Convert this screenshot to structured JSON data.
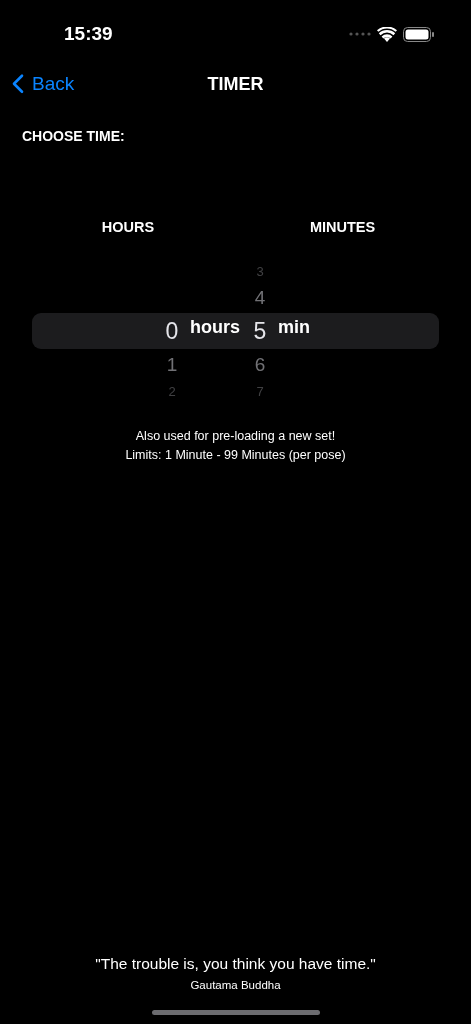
{
  "status_bar": {
    "time": "15:39"
  },
  "nav": {
    "back": "Back",
    "title": "TIMER"
  },
  "section_label": "CHOOSE TIME:",
  "picker": {
    "columns": [
      {
        "heading": "HOURS",
        "unit": "hours",
        "items": [
          {
            "value": "0",
            "selected": true
          },
          {
            "value": "1",
            "selected": false
          },
          {
            "value": "2",
            "selected": false
          }
        ]
      },
      {
        "heading": "MINUTES",
        "unit": "min",
        "items": [
          {
            "value": "3",
            "selected": false
          },
          {
            "value": "4",
            "selected": false
          },
          {
            "value": "5",
            "selected": true
          },
          {
            "value": "6",
            "selected": false
          },
          {
            "value": "7",
            "selected": false
          }
        ]
      }
    ]
  },
  "notes": [
    "Also used for pre-loading a new set!",
    "Limits: 1 Minute - 99 Minutes (per pose)"
  ],
  "quote": {
    "text": "\"The trouble is, you think you have time.\"",
    "author": "Gautama Buddha"
  }
}
